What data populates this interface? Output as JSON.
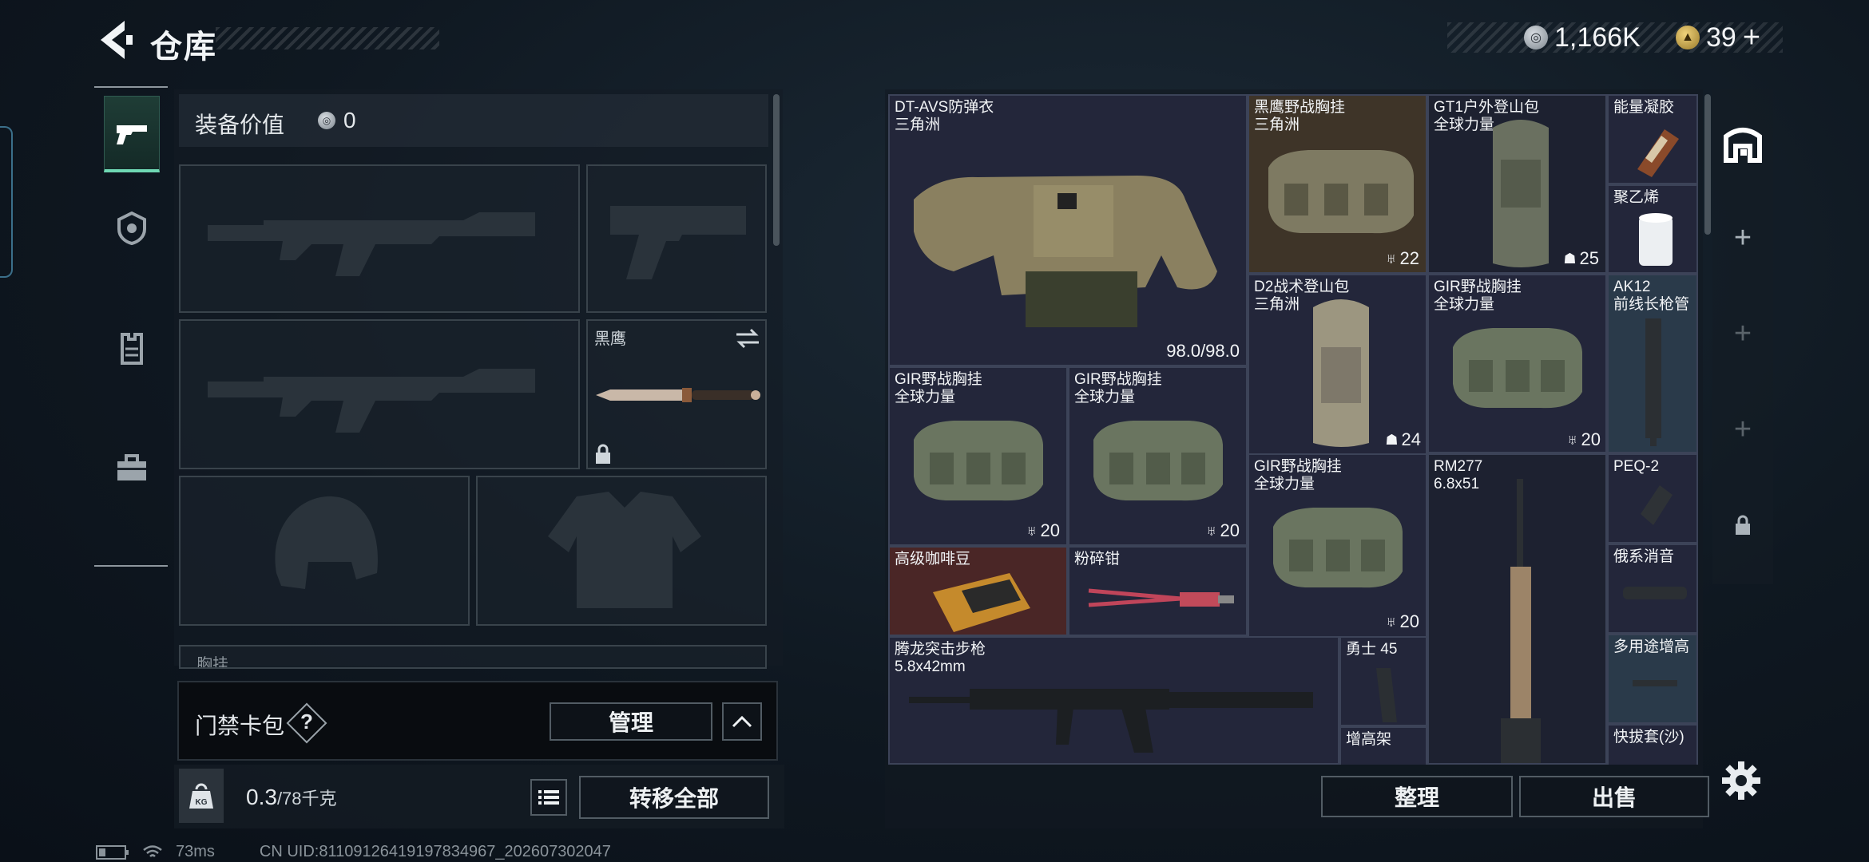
{
  "header": {
    "title": "仓库",
    "currency": [
      {
        "icon": "silver-coin-icon",
        "value": "1,166K"
      },
      {
        "icon": "gold-coin-icon",
        "value": "39"
      }
    ],
    "currency_add": "+"
  },
  "loadout": {
    "equip_value_label": "装备价值",
    "equip_value": "0",
    "melee_slot_name": "黑鹰",
    "chest_rig_label": "胸挂",
    "card_bag_label": "门禁卡包",
    "help_mark": "?",
    "manage_label": "管理",
    "weight_current": "0.3",
    "weight_max": "/78千克",
    "kg_label": "KG",
    "transfer_all_label": "转移全部"
  },
  "stash": {
    "items": [
      {
        "name": "DT-AVS防弹衣",
        "sub": "三角洲",
        "count": "98.0/98.0",
        "count_icon": ""
      },
      {
        "name": "黑鹰野战胸挂",
        "sub": "三角洲",
        "count": "22",
        "count_icon": "rig-icon"
      },
      {
        "name": "GT1户外登山包",
        "sub": "全球力量",
        "count": "25",
        "count_icon": "backpack-icon"
      },
      {
        "name": "能量凝胶",
        "sub": "",
        "count": "",
        "count_icon": ""
      },
      {
        "name": "聚乙烯",
        "sub": "",
        "count": "",
        "count_icon": ""
      },
      {
        "name": "D2战术登山包",
        "sub": "三角洲",
        "count": "24",
        "count_icon": "backpack-icon"
      },
      {
        "name": "GIR野战胸挂",
        "sub": "全球力量",
        "count": "20",
        "count_icon": "rig-icon"
      },
      {
        "name": "AK12",
        "sub": "前线长枪管",
        "count": "",
        "count_icon": ""
      },
      {
        "name": "GIR野战胸挂",
        "sub": "全球力量",
        "count": "20",
        "count_icon": "rig-icon"
      },
      {
        "name": "GIR野战胸挂",
        "sub": "全球力量",
        "count": "20",
        "count_icon": "rig-icon"
      },
      {
        "name": "GIR野战胸挂",
        "sub": "全球力量",
        "count": "20",
        "count_icon": "rig-icon"
      },
      {
        "name": "RM277",
        "sub": "6.8x51",
        "count": "",
        "count_icon": ""
      },
      {
        "name": "PEQ-2",
        "sub": "",
        "count": "",
        "count_icon": ""
      },
      {
        "name": "高级咖啡豆",
        "sub": "",
        "count": "",
        "count_icon": ""
      },
      {
        "name": "粉碎钳",
        "sub": "",
        "count": "",
        "count_icon": ""
      },
      {
        "name": "俄系消音",
        "sub": "",
        "count": "",
        "count_icon": ""
      },
      {
        "name": "腾龙突击步枪",
        "sub": "5.8x42mm",
        "count": "",
        "count_icon": ""
      },
      {
        "name": "勇士 45",
        "sub": "",
        "count": "",
        "count_icon": ""
      },
      {
        "name": "多用途增高",
        "sub": "",
        "count": "",
        "count_icon": ""
      },
      {
        "name": "增高架",
        "sub": "",
        "count": "",
        "count_icon": ""
      },
      {
        "name": "快拔套(沙)",
        "sub": "",
        "count": "",
        "count_icon": ""
      }
    ],
    "tidy_label": "整理",
    "sell_label": "出售"
  },
  "right_rail": {
    "add_symbol": "+"
  },
  "status_bar": {
    "ping": "73ms",
    "uid": "CN UID:81109126419197834967_202607302047"
  },
  "colors": {
    "accent_green": "#6fd8b4",
    "grid_bg": "#1e2233",
    "gold_item_bg": "#3e3428",
    "blue_item_bg": "#2a3a4a",
    "red_item_bg": "#4a2626"
  }
}
